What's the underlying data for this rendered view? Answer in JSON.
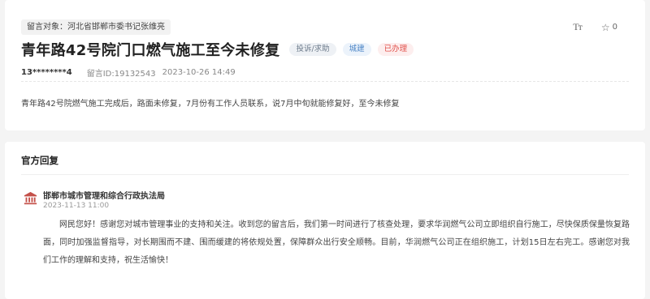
{
  "message": {
    "target_label": "留言对象：河北省邯郸市委书记张维亮",
    "font_size_icon": "Tт",
    "favorite_count": "0",
    "title": "青年路42号院门口燃气施工至今未修复",
    "category_tag": "投诉/求助",
    "department_tag": "城建",
    "status_tag": "已办理",
    "user": "13********4",
    "message_id": "留言ID:19132543",
    "datetime": "2023-10-26 14:49",
    "content": "青年路42号院燃气施工完成后，路面未修复，7月份有工作人员联系，说7月中旬就能修复好，至今未修复"
  },
  "reply": {
    "section_title": "官方回复",
    "org_name": "邯郸市城市管理和综合行政执法局",
    "datetime": "2023-11-13 11:00",
    "text": "网民您好！感谢您对城市管理事业的支持和关注。收到您的留言后，我们第一时间进行了核查处理，要求华润燃气公司立即组织自行施工，尽快保质保量恢复路面，同时加强监督指导，对长期围而不建、围而缓建的将依规处置，保障群众出行安全顺畅。目前，华润燃气公司正在组织施工，计划15日左右完工。感谢您对我们工作的理解和支持，祝生活愉快！"
  },
  "colors": {
    "status_red": "#e1514b",
    "department_blue": "#4f87c7",
    "org_icon_red": "#c4514a"
  },
  "icons": [
    "font-size-icon",
    "star-icon",
    "government-building-icon"
  ]
}
